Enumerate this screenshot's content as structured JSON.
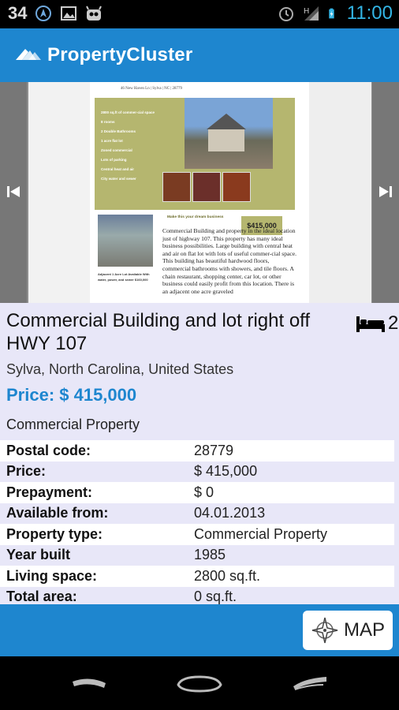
{
  "status_bar": {
    "notification_count": "34",
    "time": "11:00",
    "icons": [
      "navigation-icon",
      "image-icon",
      "android-icon",
      "alarm-icon",
      "signal-icon",
      "battery-charging-icon"
    ]
  },
  "app_bar": {
    "title": "PropertyCluster",
    "logo_icon": "propertycluster-logo-icon"
  },
  "gallery": {
    "prev_icon": "skip-previous-icon",
    "next_icon": "skip-next-icon",
    "flyer": {
      "heading": "…",
      "address_line": "46 New Haven Ln | Sylva | NC | 28779",
      "bullets": [
        "2800 sq.ft of commer-cial space",
        "8 rooms",
        "2 Double Bathrooms",
        "1 acre flat lot",
        "Zoned commercial",
        "Lots of parking",
        "Central heat and air",
        "City water and sewer"
      ],
      "tagline": "Make this your dream business",
      "price": "$415,000",
      "lot_caption": "Adjacent 1 Acre Lot Available With water, power, and sewer $160,000",
      "description": "Commercial Building and property in the ideal location just of highway 107. This property has many ideal business possibilities. Large building with central heat and air on flat lot with lots of useful commer-cial space. This building has beautiful hardwood floors, commercial bathrooms with showers, and tile floors. A chain restaurant, shopping center, car lot, or other business could easily profit from this location. There is an adjacent one acre graveled"
    }
  },
  "listing": {
    "title": "Commercial Building and lot right off HWY 107",
    "bedrooms": "2",
    "bed_icon": "bed-icon",
    "location": "Sylva, North Carolina, United States",
    "price": "Price: $ 415,000",
    "category": "Commercial Property",
    "attributes": [
      {
        "key": "Postal code:",
        "value": "28779"
      },
      {
        "key": "Price:",
        "value": "$ 415,000"
      },
      {
        "key": "Prepayment:",
        "value": "$ 0"
      },
      {
        "key": "Available from:",
        "value": "04.01.2013"
      },
      {
        "key": "Property type:",
        "value": "Commercial Property"
      },
      {
        "key": "Year built",
        "value": "1985"
      },
      {
        "key": "Living space:",
        "value": "2800 sq.ft."
      },
      {
        "key": "Total area:",
        "value": "0 sq.ft."
      }
    ]
  },
  "bottom_bar": {
    "map_label": "MAP",
    "map_icon": "compass-map-icon"
  },
  "nav_bar": {
    "icons": [
      "back-icon",
      "home-icon",
      "recent-apps-icon"
    ]
  },
  "colors": {
    "accent": "#1e86cf",
    "details_background": "#e8e7f8",
    "flyer_olive": "#b5b66f",
    "status_time": "#33b5e5"
  }
}
